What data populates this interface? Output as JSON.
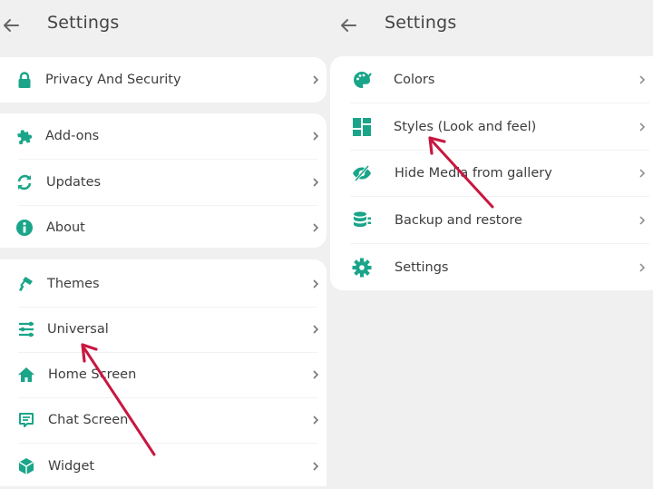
{
  "accent_color": "#1aa589",
  "annotation_color": "#c8173f",
  "left_screen": {
    "header": {
      "back_icon": "arrow-left-icon",
      "title": "Settings"
    },
    "groups": [
      {
        "items": [
          {
            "label": "Privacy And Security",
            "icon": "lock-icon"
          }
        ]
      },
      {
        "items": [
          {
            "label": "Add-ons",
            "icon": "puzzle-icon"
          },
          {
            "label": "Updates",
            "icon": "refresh-icon"
          },
          {
            "label": "About",
            "icon": "info-icon"
          }
        ]
      },
      {
        "items": [
          {
            "label": "Themes",
            "icon": "paint-roller-icon"
          },
          {
            "label": "Universal",
            "icon": "sliders-icon"
          },
          {
            "label": "Home Screen",
            "icon": "home-icon"
          },
          {
            "label": "Chat Screen",
            "icon": "chat-icon"
          },
          {
            "label": "Widget",
            "icon": "cube-icon"
          }
        ]
      }
    ],
    "annotation": {
      "type": "arrow",
      "points_to": "Universal"
    }
  },
  "right_screen": {
    "header": {
      "back_icon": "arrow-left-icon",
      "title": "Settings"
    },
    "items": [
      {
        "label": "Colors",
        "icon": "palette-icon"
      },
      {
        "label": "Styles (Look and feel)",
        "icon": "dashboard-icon"
      },
      {
        "label": "Hide Media from gallery",
        "icon": "eye-slash-icon"
      },
      {
        "label": "Backup and restore",
        "icon": "database-icon"
      },
      {
        "label": "Settings",
        "icon": "gear-icon"
      }
    ],
    "annotation": {
      "type": "arrow",
      "points_to": "Styles (Look and feel)"
    }
  }
}
